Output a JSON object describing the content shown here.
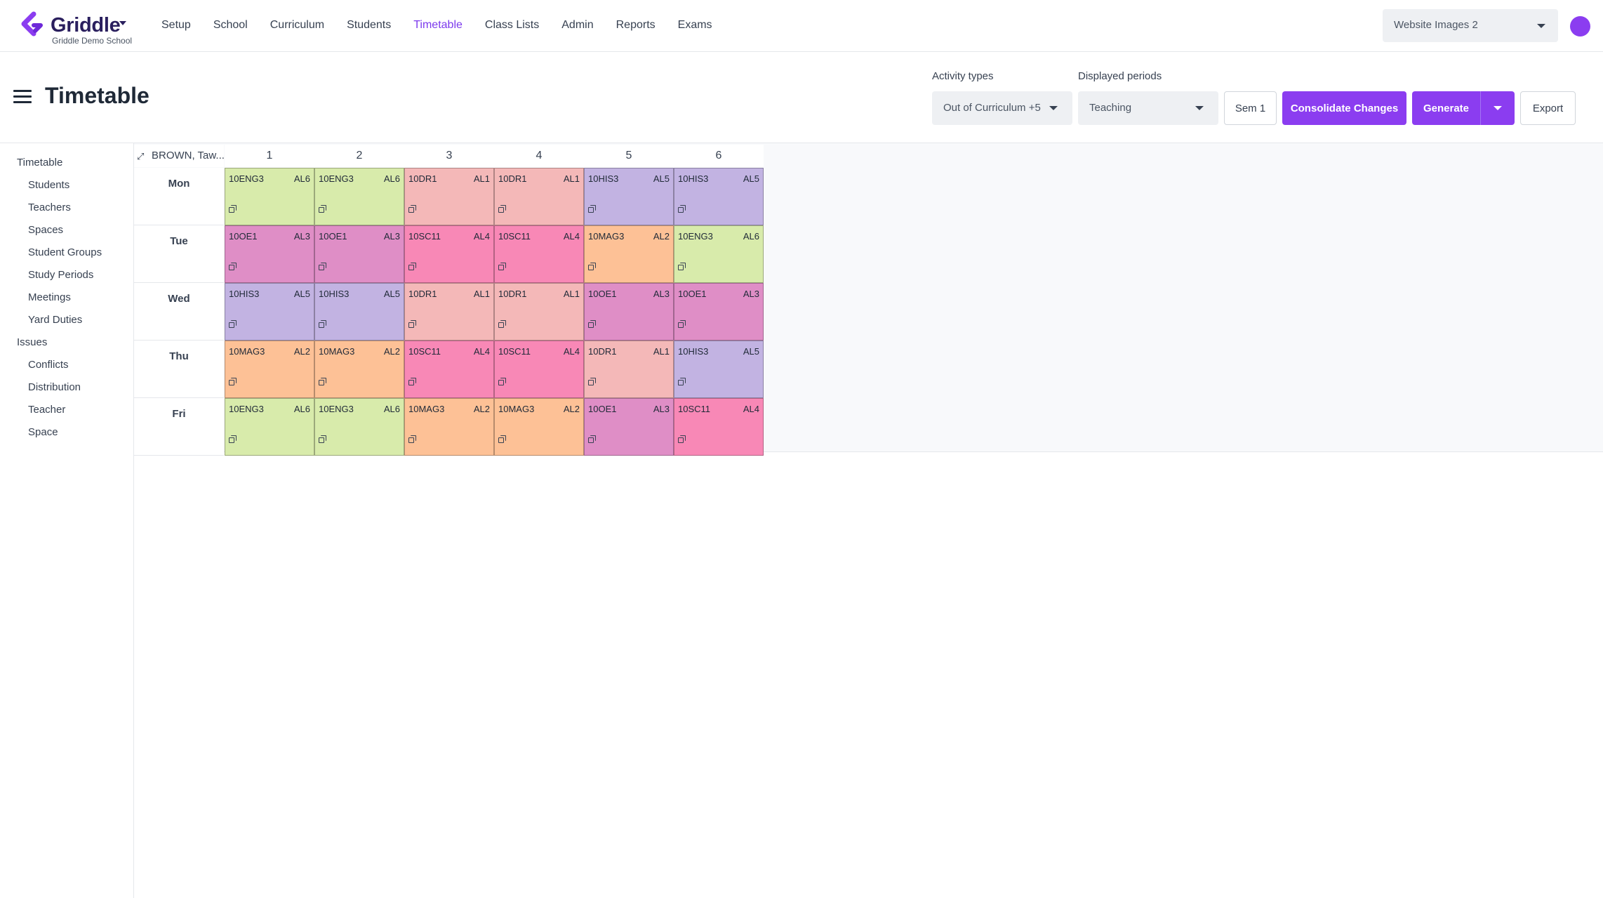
{
  "app": {
    "brand": "Griddle",
    "school": "Griddle Demo School",
    "project": "Website Images 2"
  },
  "nav": [
    "Setup",
    "School",
    "Curriculum",
    "Students",
    "Timetable",
    "Class Lists",
    "Admin",
    "Reports",
    "Exams"
  ],
  "active_nav": "Timetable",
  "header": {
    "title": "Timetable",
    "activity_types_label": "Activity types",
    "activity_types_value": "Out of Curriculum +5",
    "displayed_periods_label": "Displayed periods",
    "displayed_periods_value": "Teaching",
    "sem_button": "Sem 1",
    "consolidate_button": "Consolidate Changes",
    "generate_button": "Generate",
    "export_button": "Export"
  },
  "sidebar": {
    "sections": [
      {
        "label": "Timetable",
        "items": [
          "Students",
          "Teachers",
          "Spaces",
          "Student Groups",
          "Study Periods",
          "Meetings",
          "Yard Duties"
        ]
      },
      {
        "label": "Issues",
        "items": [
          "Conflicts",
          "Distribution",
          "Teacher",
          "Space"
        ]
      }
    ]
  },
  "colors": {
    "accent": "#8b3df0",
    "ENG": "#d8ebab",
    "DR": "#f4b8b8",
    "HIS": "#c2b3e2",
    "OE": "#df8ec6",
    "SC": "#f888b6",
    "MA": "#fdc196"
  },
  "timetable": {
    "teacher": "BROWN, Taw...",
    "periods": [
      "1",
      "2",
      "3",
      "4",
      "5",
      "6"
    ],
    "days": [
      {
        "day": "Mon",
        "cells": [
          {
            "code": "10ENG3",
            "room": "AL6",
            "subject": "ENG"
          },
          {
            "code": "10ENG3",
            "room": "AL6",
            "subject": "ENG"
          },
          {
            "code": "10DR1",
            "room": "AL1",
            "subject": "DR"
          },
          {
            "code": "10DR1",
            "room": "AL1",
            "subject": "DR"
          },
          {
            "code": "10HIS3",
            "room": "AL5",
            "subject": "HIS"
          },
          {
            "code": "10HIS3",
            "room": "AL5",
            "subject": "HIS"
          }
        ]
      },
      {
        "day": "Tue",
        "cells": [
          {
            "code": "10OE1",
            "room": "AL3",
            "subject": "OE"
          },
          {
            "code": "10OE1",
            "room": "AL3",
            "subject": "OE"
          },
          {
            "code": "10SC11",
            "room": "AL4",
            "subject": "SC"
          },
          {
            "code": "10SC11",
            "room": "AL4",
            "subject": "SC"
          },
          {
            "code": "10MAG3",
            "room": "AL2",
            "subject": "MA"
          },
          {
            "code": "10ENG3",
            "room": "AL6",
            "subject": "ENG"
          }
        ]
      },
      {
        "day": "Wed",
        "cells": [
          {
            "code": "10HIS3",
            "room": "AL5",
            "subject": "HIS"
          },
          {
            "code": "10HIS3",
            "room": "AL5",
            "subject": "HIS"
          },
          {
            "code": "10DR1",
            "room": "AL1",
            "subject": "DR"
          },
          {
            "code": "10DR1",
            "room": "AL1",
            "subject": "DR"
          },
          {
            "code": "10OE1",
            "room": "AL3",
            "subject": "OE"
          },
          {
            "code": "10OE1",
            "room": "AL3",
            "subject": "OE"
          }
        ]
      },
      {
        "day": "Thu",
        "cells": [
          {
            "code": "10MAG3",
            "room": "AL2",
            "subject": "MA"
          },
          {
            "code": "10MAG3",
            "room": "AL2",
            "subject": "MA"
          },
          {
            "code": "10SC11",
            "room": "AL4",
            "subject": "SC"
          },
          {
            "code": "10SC11",
            "room": "AL4",
            "subject": "SC"
          },
          {
            "code": "10DR1",
            "room": "AL1",
            "subject": "DR"
          },
          {
            "code": "10HIS3",
            "room": "AL5",
            "subject": "HIS"
          }
        ]
      },
      {
        "day": "Fri",
        "cells": [
          {
            "code": "10ENG3",
            "room": "AL6",
            "subject": "ENG"
          },
          {
            "code": "10ENG3",
            "room": "AL6",
            "subject": "ENG"
          },
          {
            "code": "10MAG3",
            "room": "AL2",
            "subject": "MA"
          },
          {
            "code": "10MAG3",
            "room": "AL2",
            "subject": "MA"
          },
          {
            "code": "10OE1",
            "room": "AL3",
            "subject": "OE"
          },
          {
            "code": "10SC11",
            "room": "AL4",
            "subject": "SC"
          }
        ]
      }
    ]
  }
}
